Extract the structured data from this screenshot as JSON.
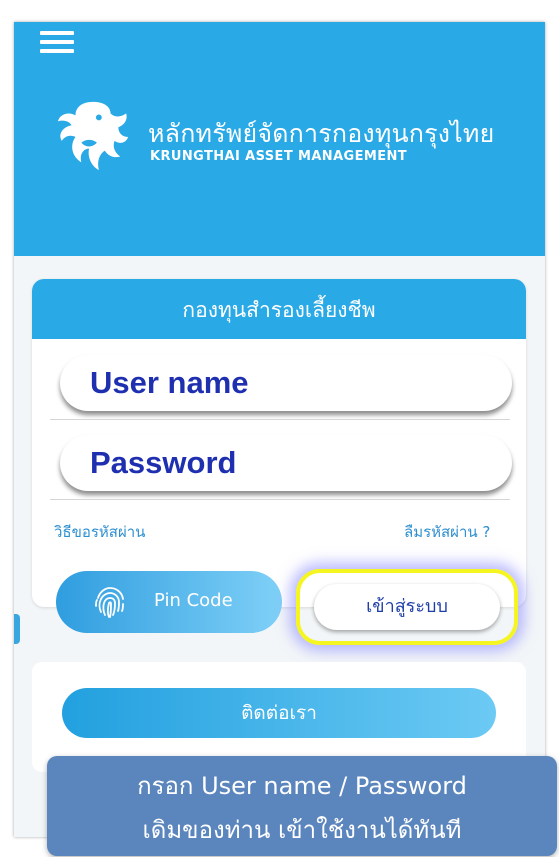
{
  "header": {
    "brand_th": "หลักทรัพย์จัดการกองทุนกรุงไทย",
    "brand_en": "KRUNGTHAI ASSET MANAGEMENT",
    "menu_icon": "hamburger-menu-icon",
    "logo_icon": "garuda-logo-icon",
    "background_color": "#29a9e6"
  },
  "login_card": {
    "title": "กองทุนสำรองเลี้ยงชีพ",
    "username_placeholder": "User name",
    "password_placeholder": "Password",
    "how_to_request_password": "วิธีขอรหัสผ่าน",
    "forgot_password": "ลืมรหัสผ่าน ?",
    "pin_code_label": "Pin Code",
    "pin_icon": "fingerprint-icon",
    "login_label": "เข้าสู่ระบบ"
  },
  "contact": {
    "label": "ติดต่อเรา"
  },
  "overlay": {
    "line1": "กรอก User name / Password",
    "line2": "เดิมของท่าน เข้าใช้งานได้ทันที"
  },
  "colors": {
    "accent": "#29a9e6",
    "highlight_border": "#f5f521",
    "input_text": "#1e2fb0",
    "overlay_bg": "#5b85bd"
  }
}
